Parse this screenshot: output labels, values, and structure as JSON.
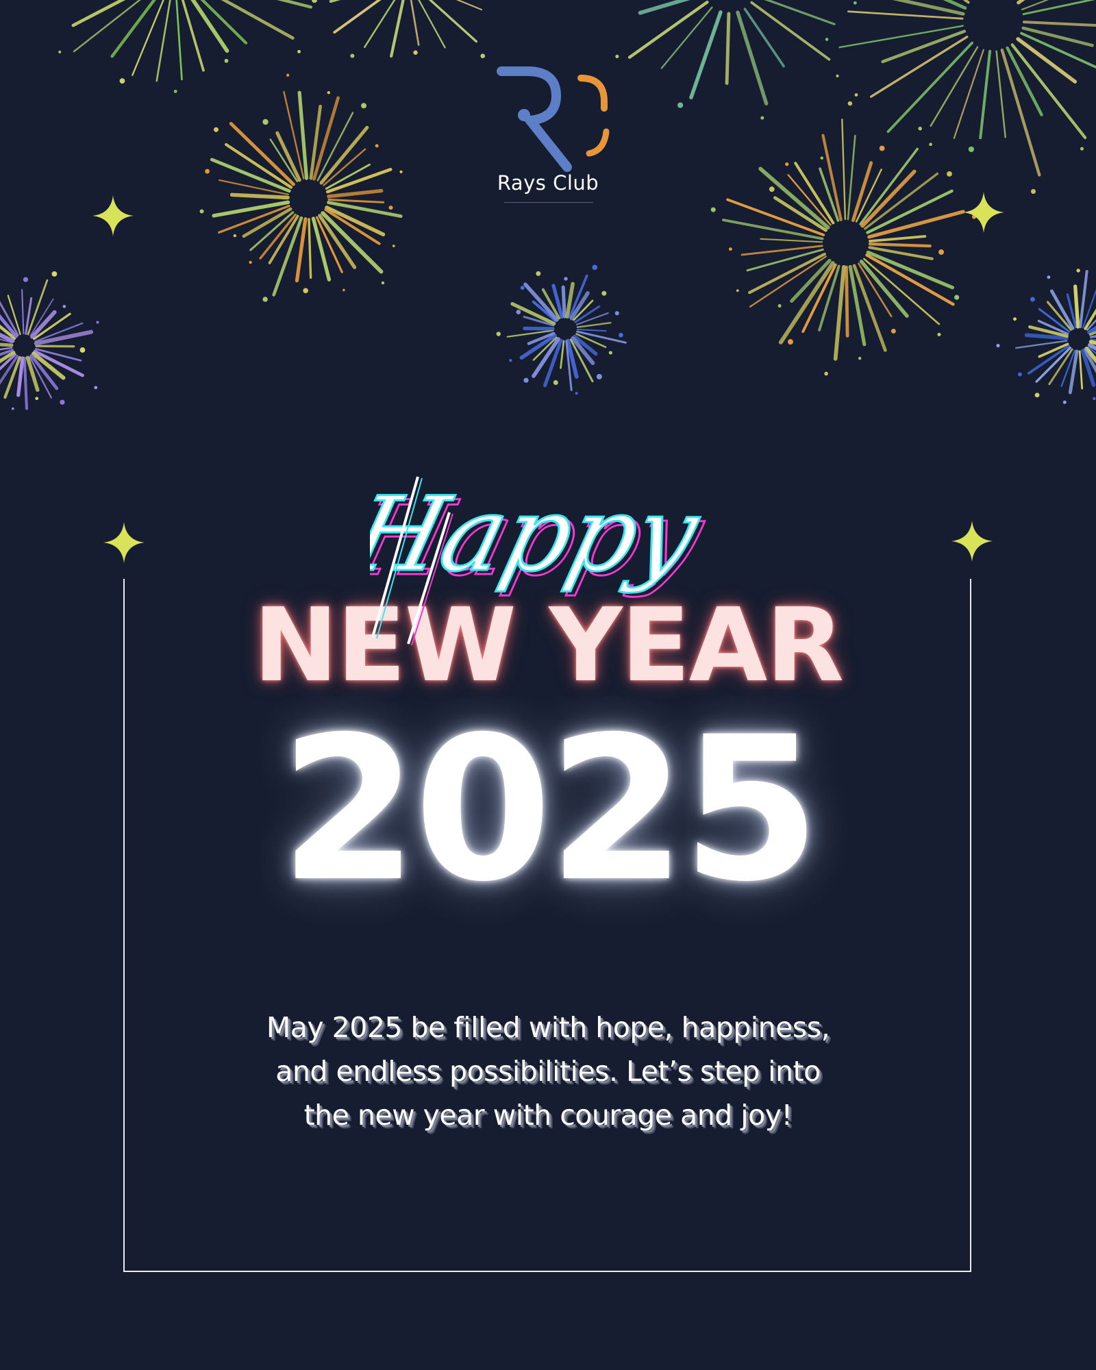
{
  "brand": {
    "name": "Rays Club",
    "logo_colors": {
      "r_letter": "#5d7fc7",
      "c_letter": "#e7963a",
      "dot": "#5d7fc7"
    }
  },
  "card": {
    "script_heading": "Happy",
    "heading": "NEW YEAR",
    "year": "2025",
    "message_lines": [
      "May 2025 be filled with hope, happiness,",
      "and endless possibilities. Let’s step into",
      "the new year with courage and joy!"
    ]
  },
  "colors": {
    "background": "#161d30",
    "sparkle": "#d8e35a",
    "heading": "#fde2e2",
    "heading_glow": "#ff8a8a",
    "year": "#ffffff",
    "frame": "#e9ebf1",
    "happy_cyan": "#38e6f2",
    "happy_magenta": "#f03ad2"
  },
  "decorations": {
    "fireworks": [
      {
        "name": "firework-top-left",
        "palette": [
          "#7bbf55",
          "#a7c76a",
          "#c9d36d"
        ]
      },
      {
        "name": "firework-top-center-left",
        "palette": [
          "#a6c66e",
          "#d7c27a",
          "#b9c97a"
        ]
      },
      {
        "name": "firework-top-center-right",
        "palette": [
          "#6fb59a",
          "#8fc27b",
          "#b5c46f"
        ]
      },
      {
        "name": "firework-top-right",
        "palette": [
          "#cbbd6f",
          "#a8c16c",
          "#7cbf6a"
        ]
      },
      {
        "name": "firework-mid-left",
        "palette": [
          "#e39a3c",
          "#a9c86b",
          "#d5c45b"
        ]
      },
      {
        "name": "firework-mid-right",
        "palette": [
          "#e29d45",
          "#c8c25e",
          "#9cc36a"
        ]
      },
      {
        "name": "firework-center-small",
        "palette": [
          "#4a6be0",
          "#7e8fd8",
          "#b7c86b"
        ]
      },
      {
        "name": "firework-edge-left",
        "palette": [
          "#d4d86a",
          "#8b7ad9",
          "#a98fe6"
        ]
      },
      {
        "name": "firework-edge-right",
        "palette": [
          "#3f69d8",
          "#d1cf69",
          "#8ea3e4"
        ]
      }
    ]
  }
}
